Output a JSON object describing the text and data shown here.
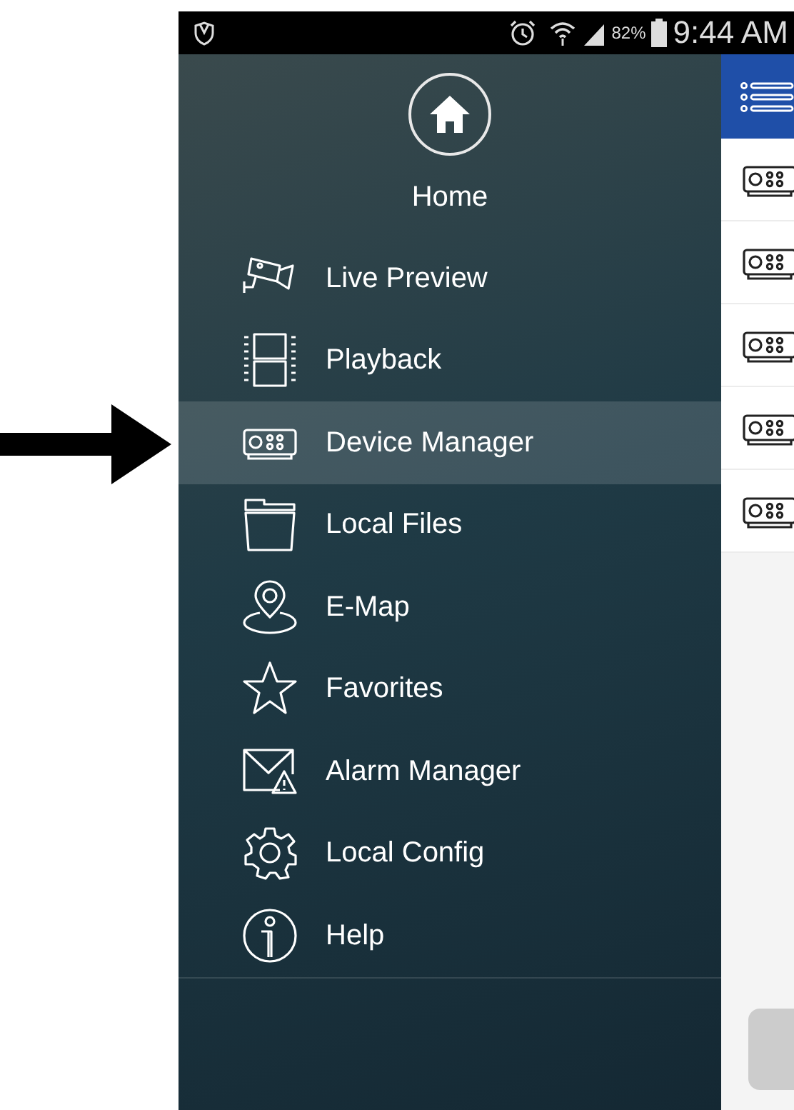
{
  "status_bar": {
    "battery_percent": "82%",
    "time": "9:44 AM"
  },
  "drawer": {
    "home_label": "Home",
    "items": [
      {
        "label": "Live Preview",
        "kind": "camera",
        "selected": false
      },
      {
        "label": "Playback",
        "kind": "film",
        "selected": false
      },
      {
        "label": "Device Manager",
        "kind": "device",
        "selected": true
      },
      {
        "label": "Local Files",
        "kind": "folder",
        "selected": false
      },
      {
        "label": "E-Map",
        "kind": "map",
        "selected": false
      },
      {
        "label": "Favorites",
        "kind": "star",
        "selected": false
      },
      {
        "label": "Alarm Manager",
        "kind": "alarm",
        "selected": false
      },
      {
        "label": "Local Config",
        "kind": "gear",
        "selected": false
      },
      {
        "label": "Help",
        "kind": "help",
        "selected": false
      }
    ]
  },
  "device_list": {
    "rows": [
      {
        "kind": "device"
      },
      {
        "kind": "device"
      },
      {
        "kind": "device"
      },
      {
        "kind": "device"
      },
      {
        "kind": "device"
      }
    ]
  }
}
